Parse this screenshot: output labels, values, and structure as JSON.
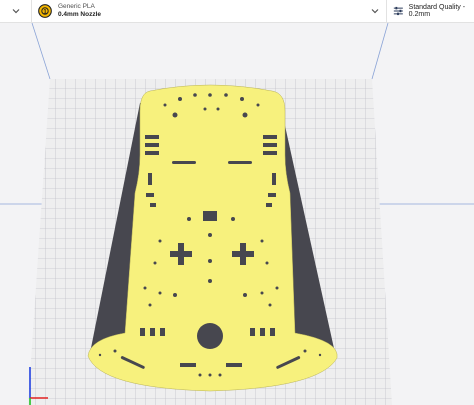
{
  "toolbar": {
    "material": {
      "name": "Generic PLA",
      "nozzle": "0.4mm Nozzle",
      "badge_color": "#f5b700",
      "icon": "spool-icon"
    },
    "quality": {
      "label": "Standard Quality - 0.2mm",
      "icon": "settings-sliders-icon"
    }
  },
  "colors": {
    "model": "#f7f17d",
    "shadow": "#47474f",
    "build_plate": "#eeeeef",
    "grid": "#b9b9c2",
    "axis_x": "#e02020",
    "axis_y": "#20c020",
    "axis_z": "#2040e0",
    "build_volume": "#6c8fcc"
  }
}
